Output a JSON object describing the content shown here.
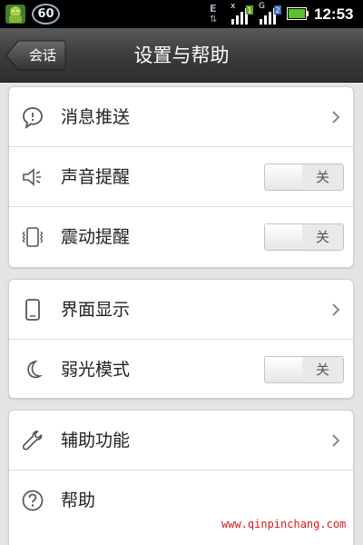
{
  "status_bar": {
    "badge": "60",
    "network_e": "E",
    "sim1_label": "1",
    "sim2_label": "2",
    "x_mark": "x",
    "g_mark": "G",
    "time": "12:53"
  },
  "header": {
    "back_label": "会话",
    "title": "设置与帮助"
  },
  "groups": [
    {
      "items": [
        {
          "label": "消息推送",
          "icon": "message-bubble-icon",
          "control": "chevron"
        },
        {
          "label": "声音提醒",
          "icon": "speaker-icon",
          "control": "toggle",
          "state": "关"
        },
        {
          "label": "震动提醒",
          "icon": "vibrate-icon",
          "control": "toggle",
          "state": "关"
        }
      ]
    },
    {
      "items": [
        {
          "label": "界面显示",
          "icon": "phone-screen-icon",
          "control": "chevron"
        },
        {
          "label": "弱光模式",
          "icon": "moon-icon",
          "control": "toggle",
          "state": "关"
        }
      ]
    },
    {
      "items": [
        {
          "label": "辅助功能",
          "icon": "wrench-icon",
          "control": "chevron"
        },
        {
          "label": "帮助",
          "icon": "help-icon",
          "control": "none"
        }
      ]
    }
  ],
  "watermark": "www.qinpinchang.com",
  "colors": {
    "status_bar_bg": "#000000",
    "title_bar_bg": "#3c3c3c",
    "page_bg": "#e4e4e4",
    "card_bg": "#ffffff",
    "watermark": "#e0161c"
  }
}
